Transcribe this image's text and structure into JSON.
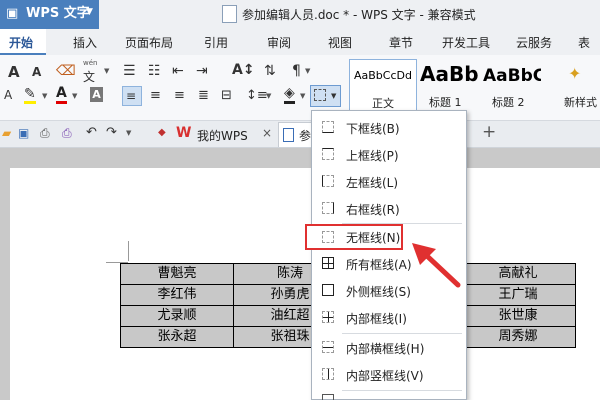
{
  "titlebar": {
    "app_name": "WPS 文字",
    "doc_title": "参加编辑人员.doc * - WPS 文字 - 兼容模式"
  },
  "ribbon_tabs": [
    {
      "label": "开始",
      "active": true
    },
    {
      "label": "插入"
    },
    {
      "label": "页面布局"
    },
    {
      "label": "引用"
    },
    {
      "label": "审阅"
    },
    {
      "label": "视图"
    },
    {
      "label": "章节"
    },
    {
      "label": "开发工具"
    },
    {
      "label": "云服务"
    },
    {
      "label": "表"
    }
  ],
  "font_controls": {
    "grow": "A",
    "shrink": "A",
    "phonetic": "wén",
    "phonetic_char": "文",
    "text_color_glyph": "A",
    "char_shading": "A"
  },
  "styles": [
    {
      "preview": "AaBbCcDd",
      "label": "正文"
    },
    {
      "preview": "AaBb",
      "label": "标题 1"
    },
    {
      "preview": "AaBbC",
      "label": "标题 2"
    },
    {
      "preview": "",
      "label": "新样式"
    }
  ],
  "doc_tabs": [
    {
      "label": "我的WPS"
    },
    {
      "label": "参"
    }
  ],
  "table_rows": [
    [
      "曹魁亮",
      "陈涛",
      "",
      "高献礼"
    ],
    [
      "李红伟",
      "孙勇虎",
      "",
      "王广瑞"
    ],
    [
      "尤录顺",
      "油红超",
      "",
      "张世康"
    ],
    [
      "张永超",
      "张祖珠",
      "",
      "周秀娜"
    ]
  ],
  "border_menu": {
    "items": [
      {
        "label": "下框线(B)"
      },
      {
        "label": "上框线(P)"
      },
      {
        "label": "左框线(L)"
      },
      {
        "label": "右框线(R)"
      },
      {
        "label": "无框线(N)",
        "highlighted": true
      },
      {
        "label": "所有框线(A)"
      },
      {
        "label": "外侧框线(S)"
      },
      {
        "label": "内部框线(I)"
      },
      {
        "label": "内部横框线(H)"
      },
      {
        "label": "内部竖框线(V)"
      },
      {
        "label": ""
      }
    ]
  },
  "colors": {
    "ribbon_blue": "#4a7fbd",
    "highlight_red": "#e03030",
    "table_fill": "#c8c8c8"
  }
}
